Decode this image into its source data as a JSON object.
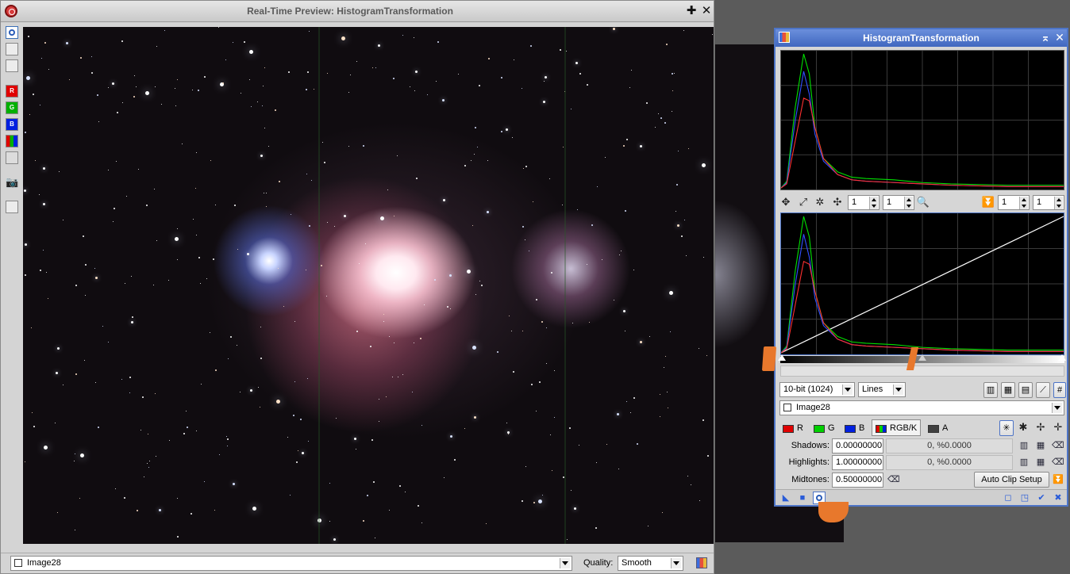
{
  "preview": {
    "title": "Real-Time Preview: HistogramTransformation",
    "image_selector": "Image28",
    "quality_label": "Quality:",
    "quality_value": "Smooth",
    "left_toolbar": {
      "channels": [
        "R",
        "G",
        "B",
        "RGB",
        "A"
      ],
      "channel_colors": [
        "#e00000",
        "#00b000",
        "#0020e0",
        "#2060c0",
        "#9a9a9a"
      ]
    }
  },
  "ht": {
    "title": "HistogramTransformation",
    "top_controls": {
      "zoom_h": "1",
      "zoom_v": "1",
      "zoom_h2": "1",
      "zoom_v2": "1"
    },
    "resolution": "10-bit (1024)",
    "graph_style": "Lines",
    "view": "Image28",
    "channels": [
      {
        "label": "R",
        "color": "#e00000"
      },
      {
        "label": "G",
        "color": "#00d000"
      },
      {
        "label": "B",
        "color": "#0020e0"
      },
      {
        "label": "RGB/K",
        "color": "#3a6ec0"
      },
      {
        "label": "A",
        "color": "#404040"
      }
    ],
    "shadows_label": "Shadows:",
    "shadows_value": "0.00000000",
    "shadows_info": "0, %0.0000",
    "highlights_label": "Highlights:",
    "highlights_value": "1.00000000",
    "highlights_info": "0, %0.0000",
    "midtones_label": "Midtones:",
    "midtones_value": "0.50000000",
    "auto_clip_label": "Auto Clip Setup"
  },
  "chart_data": {
    "type": "line",
    "xlim": [
      0,
      1
    ],
    "ylim": [
      0,
      1
    ],
    "series": [
      {
        "name": "G",
        "color": "#00e000",
        "x": [
          0,
          0.02,
          0.05,
          0.08,
          0.1,
          0.12,
          0.15,
          0.2,
          0.25,
          0.3,
          0.4,
          0.5,
          0.6,
          0.8,
          1.0
        ],
        "y": [
          0,
          0.05,
          0.6,
          1.0,
          0.85,
          0.45,
          0.22,
          0.12,
          0.08,
          0.07,
          0.06,
          0.04,
          0.03,
          0.02,
          0.02
        ]
      },
      {
        "name": "B",
        "color": "#3050ff",
        "x": [
          0,
          0.02,
          0.05,
          0.08,
          0.1,
          0.12,
          0.15,
          0.2,
          0.25,
          0.3,
          0.4,
          0.5,
          0.6,
          0.8,
          1.0
        ],
        "y": [
          0,
          0.04,
          0.5,
          0.87,
          0.7,
          0.4,
          0.2,
          0.1,
          0.06,
          0.05,
          0.04,
          0.03,
          0.02,
          0.01,
          0.01
        ]
      },
      {
        "name": "R",
        "color": "#ff3030",
        "x": [
          0,
          0.02,
          0.05,
          0.08,
          0.1,
          0.12,
          0.15,
          0.2,
          0.25,
          0.3,
          0.4,
          0.5,
          0.6,
          0.8,
          1.0
        ],
        "y": [
          0,
          0.03,
          0.35,
          0.67,
          0.65,
          0.45,
          0.22,
          0.1,
          0.06,
          0.05,
          0.04,
          0.03,
          0.02,
          0.01,
          0.01
        ]
      }
    ],
    "transfer_curve": {
      "color": "#ffffff",
      "x": [
        0,
        1
      ],
      "y": [
        0,
        1
      ]
    }
  }
}
